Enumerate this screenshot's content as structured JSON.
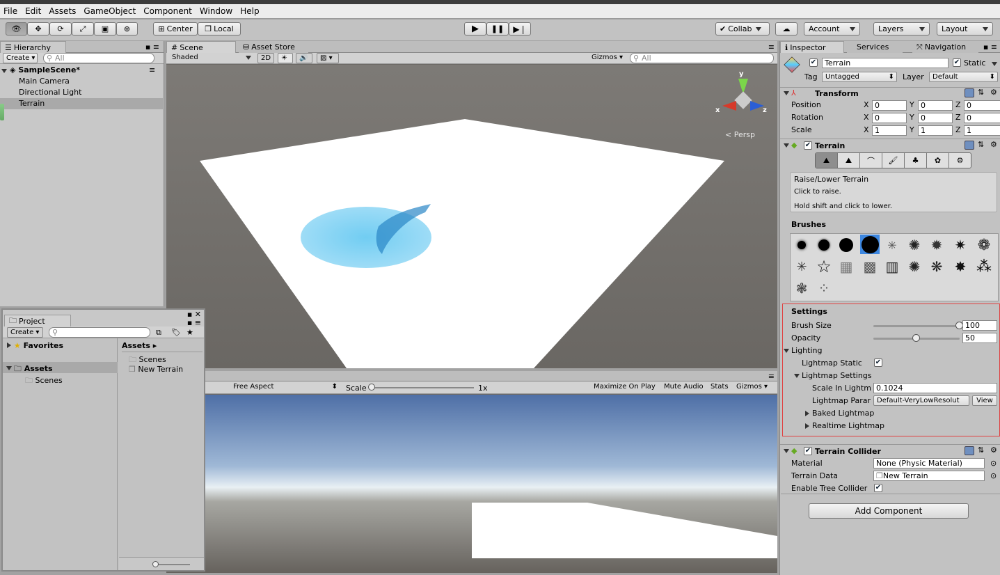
{
  "menu": [
    "File",
    "Edit",
    "Assets",
    "GameObject",
    "Component",
    "Window",
    "Help"
  ],
  "toolbar": {
    "center": "Center",
    "local": "Local",
    "collab": "Collab",
    "account": "Account",
    "layers": "Layers",
    "layout": "Layout"
  },
  "hierarchy": {
    "tab": "Hierarchy",
    "create": "Create",
    "search_placeholder": "All",
    "scene": "SampleScene*",
    "items": [
      "Main Camera",
      "Directional Light",
      "Terrain"
    ]
  },
  "scene_view": {
    "tab": "Scene",
    "asset_store_tab": "Asset Store",
    "shading": "Shaded",
    "mode2d": "2D",
    "gizmos": "Gizmos",
    "search_placeholder": "All",
    "persp": "Persp",
    "axis_x": "x",
    "axis_y": "y",
    "axis_z": "z"
  },
  "game_view": {
    "aspect": "Free Aspect",
    "scale_label": "Scale",
    "scale_value": "1x",
    "maximize": "Maximize On Play",
    "mute": "Mute Audio",
    "stats": "Stats",
    "gizmos": "Gizmos"
  },
  "project": {
    "tab": "Project",
    "create": "Create",
    "favorites": "Favorites",
    "assets": "Assets",
    "folder_scenes": "Scenes",
    "breadcrumb": "Assets",
    "items": [
      "Scenes",
      "New Terrain"
    ]
  },
  "inspector": {
    "tabs": [
      "Inspector",
      "Services",
      "Navigation"
    ],
    "object_name": "Terrain",
    "static_label": "Static",
    "tag_label": "Tag",
    "tag_value": "Untagged",
    "layer_label": "Layer",
    "layer_value": "Default",
    "transform": {
      "title": "Transform",
      "rows": [
        {
          "label": "Position",
          "x": "0",
          "y": "0",
          "z": "0"
        },
        {
          "label": "Rotation",
          "x": "0",
          "y": "0",
          "z": "0"
        },
        {
          "label": "Scale",
          "x": "1",
          "y": "1",
          "z": "1"
        }
      ]
    },
    "terrain": {
      "title": "Terrain",
      "tool_title": "Raise/Lower Terrain",
      "tool_line1": "Click to raise.",
      "tool_line2": "Hold shift and click to lower.",
      "brushes": "Brushes"
    },
    "settings": {
      "title": "Settings",
      "brush_size_label": "Brush Size",
      "brush_size": "100",
      "brush_size_level": 1.0,
      "opacity_label": "Opacity",
      "opacity": "50",
      "opacity_level": 0.5,
      "lighting": "Lighting",
      "lightmap_static": "Lightmap Static",
      "lightmap_settings": "Lightmap Settings",
      "scale_label": "Scale In Lightm",
      "scale_value": "0.1024",
      "param_label": "Lightmap Parar",
      "param_value": "Default-VeryLowResolut",
      "view": "View",
      "baked": "Baked Lightmap",
      "realtime": "Realtime Lightmap"
    },
    "collider": {
      "title": "Terrain Collider",
      "material_label": "Material",
      "material_value": "None (Physic Material)",
      "data_label": "Terrain Data",
      "data_value": "New Terrain",
      "tree_label": "Enable Tree Collider"
    },
    "add_component": "Add Component"
  },
  "colors": {
    "accent": "#3d87e0",
    "selection": "#a9a9a9",
    "settings_border": "#e04040"
  }
}
